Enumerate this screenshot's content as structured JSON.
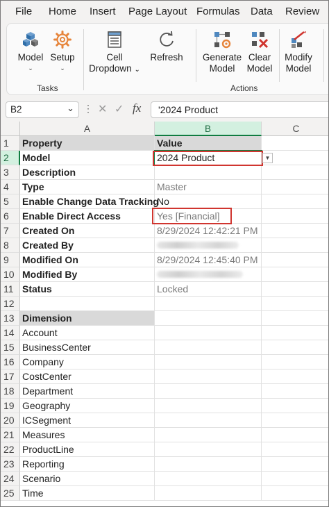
{
  "menu": [
    "File",
    "Home",
    "Insert",
    "Page Layout",
    "Formulas",
    "Data",
    "Review"
  ],
  "ribbon": {
    "tasks_group": "Tasks",
    "actions_group": "Actions",
    "buttons": {
      "model": "Model",
      "setup": "Setup",
      "cell_line1": "Cell",
      "cell_line2": "Dropdown",
      "refresh": "Refresh",
      "generate_line1": "Generate",
      "generate_line2": "Model",
      "clear_line1": "Clear",
      "clear_line2": "Model",
      "modify_line1": "Modify",
      "modify_line2": "Model"
    }
  },
  "formula_bar": {
    "name_box": "B2",
    "fx": "fx",
    "content": "'2024 Product"
  },
  "columns": [
    "A",
    "B",
    "C"
  ],
  "rows": [
    {
      "num": "1",
      "a": "Property",
      "b": "Value"
    },
    {
      "num": "2",
      "a": "Model",
      "b": "2024 Product"
    },
    {
      "num": "3",
      "a": "Description",
      "b": ""
    },
    {
      "num": "4",
      "a": "Type",
      "b": "Master"
    },
    {
      "num": "5",
      "a": "Enable Change Data Tracking",
      "b": "No"
    },
    {
      "num": "6",
      "a": "Enable Direct Access",
      "b": "Yes [Financial]"
    },
    {
      "num": "7",
      "a": "Created On",
      "b": "8/29/2024 12:42:21 PM"
    },
    {
      "num": "8",
      "a": "Created By",
      "b": ""
    },
    {
      "num": "9",
      "a": "Modified On",
      "b": "8/29/2024 12:45:40 PM"
    },
    {
      "num": "10",
      "a": "Modified By",
      "b": ""
    },
    {
      "num": "11",
      "a": "Status",
      "b": "Locked"
    },
    {
      "num": "12",
      "a": "",
      "b": ""
    },
    {
      "num": "13",
      "a": "Dimension",
      "b": ""
    },
    {
      "num": "14",
      "a": "Account",
      "b": ""
    },
    {
      "num": "15",
      "a": "BusinessCenter",
      "b": ""
    },
    {
      "num": "16",
      "a": "Company",
      "b": ""
    },
    {
      "num": "17",
      "a": "CostCenter",
      "b": ""
    },
    {
      "num": "18",
      "a": "Department",
      "b": ""
    },
    {
      "num": "19",
      "a": "Geography",
      "b": ""
    },
    {
      "num": "20",
      "a": "ICSegment",
      "b": ""
    },
    {
      "num": "21",
      "a": "Measures",
      "b": ""
    },
    {
      "num": "22",
      "a": "ProductLine",
      "b": ""
    },
    {
      "num": "23",
      "a": "Reporting",
      "b": ""
    },
    {
      "num": "24",
      "a": "Scenario",
      "b": ""
    },
    {
      "num": "25",
      "a": "Time",
      "b": ""
    }
  ],
  "colors": {
    "accent_green": "#107c41",
    "highlight_red": "#d0352f",
    "header_shade": "#d9d9d9"
  }
}
